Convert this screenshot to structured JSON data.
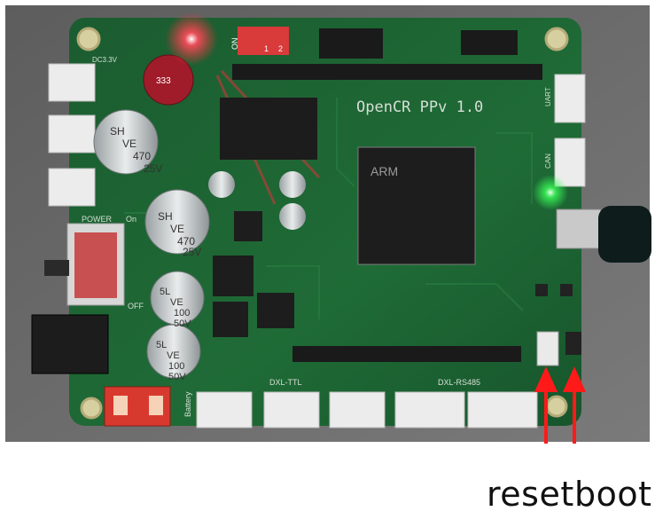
{
  "board": {
    "title": "OpenCR PPv 1.0",
    "silkscreen": {
      "power": "POWER",
      "on": "On",
      "off": "OFF",
      "dxl_ttl": "DXL-TTL",
      "dxl_rs485": "DXL-RS485",
      "battery": "Battery",
      "uart": "UART",
      "can": "CAN",
      "dc33": "DC3.3V",
      "dip_on": "ON",
      "dip_1": "1",
      "dip_2": "2"
    },
    "capacitors": [
      {
        "id": "cap1",
        "lines": [
          "SH",
          "VE",
          "470",
          "25V"
        ]
      },
      {
        "id": "cap2",
        "lines": [
          "SH",
          "VE",
          "470",
          "25V"
        ]
      },
      {
        "id": "cap3",
        "lines": [
          "5L",
          "VE",
          "100",
          "50V"
        ]
      },
      {
        "id": "cap4",
        "lines": [
          "5L",
          "VE",
          "100",
          "50V"
        ]
      }
    ],
    "mcu": {
      "label": "ARM"
    },
    "buzzer": {
      "label": "333"
    }
  },
  "captions": {
    "reset": "reset",
    "boot": "boot"
  },
  "colors": {
    "pcb": "#1e6b34",
    "pcb_dark": "#15502a",
    "background": "#6f6f6f",
    "arrow": "#ff1a1a",
    "led_red": "#ff2a3a",
    "led_green": "#39ff58"
  }
}
